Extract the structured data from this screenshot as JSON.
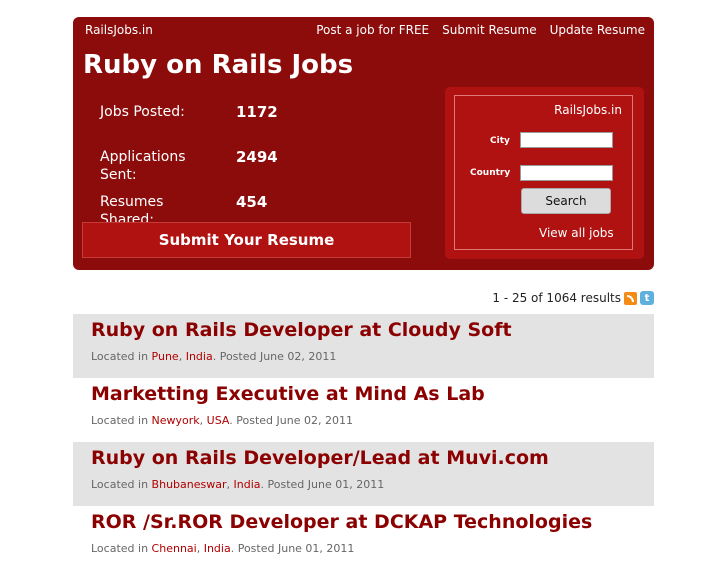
{
  "header": {
    "logo_text": "RailsJobs.in",
    "nav": [
      "Post a job for FREE",
      "Submit Resume",
      "Update Resume"
    ],
    "title": "Ruby on Rails Jobs",
    "stats": [
      {
        "label": "Jobs Posted:",
        "value": "1172"
      },
      {
        "label": "Applications Sent:",
        "value": "2494"
      },
      {
        "label": "Resumes Shared:",
        "value": "454"
      }
    ],
    "submit_label": "Submit Your Resume"
  },
  "search": {
    "brand": "RailsJobs.in",
    "city_label": "City",
    "city_value": "",
    "country_label": "Country",
    "country_value": "",
    "button_label": "Search",
    "view_all": "View all jobs"
  },
  "results": {
    "summary": "1 - 25 of 1064 results",
    "twitter_glyph": "t"
  },
  "jobs": [
    {
      "title": "Ruby on Rails Developer at Cloudy Soft",
      "prefix": "Located in ",
      "city": "Pune",
      "sep": ", ",
      "country": "India",
      "posted": ". Posted June 02, 2011"
    },
    {
      "title": "Marketting Executive at Mind As Lab",
      "prefix": "Located in ",
      "city": "Newyork",
      "sep": ", ",
      "country": "USA",
      "posted": ". Posted June 02, 2011"
    },
    {
      "title": "Ruby on Rails Developer/Lead at Muvi.com",
      "prefix": "Located in ",
      "city": "Bhubaneswar",
      "sep": ", ",
      "country": "India",
      "posted": ". Posted June 01, 2011"
    },
    {
      "title": "ROR /Sr.ROR Developer at DCKAP Technologies",
      "prefix": "Located in ",
      "city": "Chennai",
      "sep": ", ",
      "country": "India",
      "posted": ". Posted June 01, 2011"
    }
  ],
  "colors": {
    "header_bg": "#8c0c0c",
    "accent": "#b01111",
    "job_title": "#8b0000",
    "row_alt": "#e3e3e3"
  }
}
